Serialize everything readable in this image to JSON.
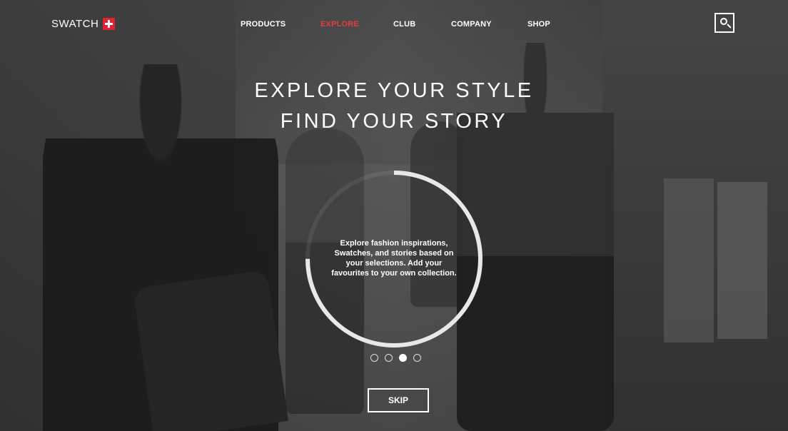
{
  "brand": {
    "name": "SWATCH",
    "accent_color": "#e0242f"
  },
  "nav": {
    "items": [
      {
        "label": "PRODUCTS",
        "active": false
      },
      {
        "label": "EXPLORE",
        "active": true
      },
      {
        "label": "CLUB",
        "active": false
      },
      {
        "label": "COMPANY",
        "active": false
      },
      {
        "label": "SHOP",
        "active": false
      }
    ],
    "active_color": "#e63a45",
    "search_icon": "search-icon"
  },
  "hero": {
    "title_line1": "EXPLORE YOUR STYLE",
    "title_line2": "FIND YOUR STORY",
    "description": "Explore fashion inspirations, Swatches, and stories based on your selections. Add your favourites to your own collection.",
    "progress": 0.75
  },
  "pager": {
    "total": 4,
    "current": 3
  },
  "skip_label": "SKIP"
}
